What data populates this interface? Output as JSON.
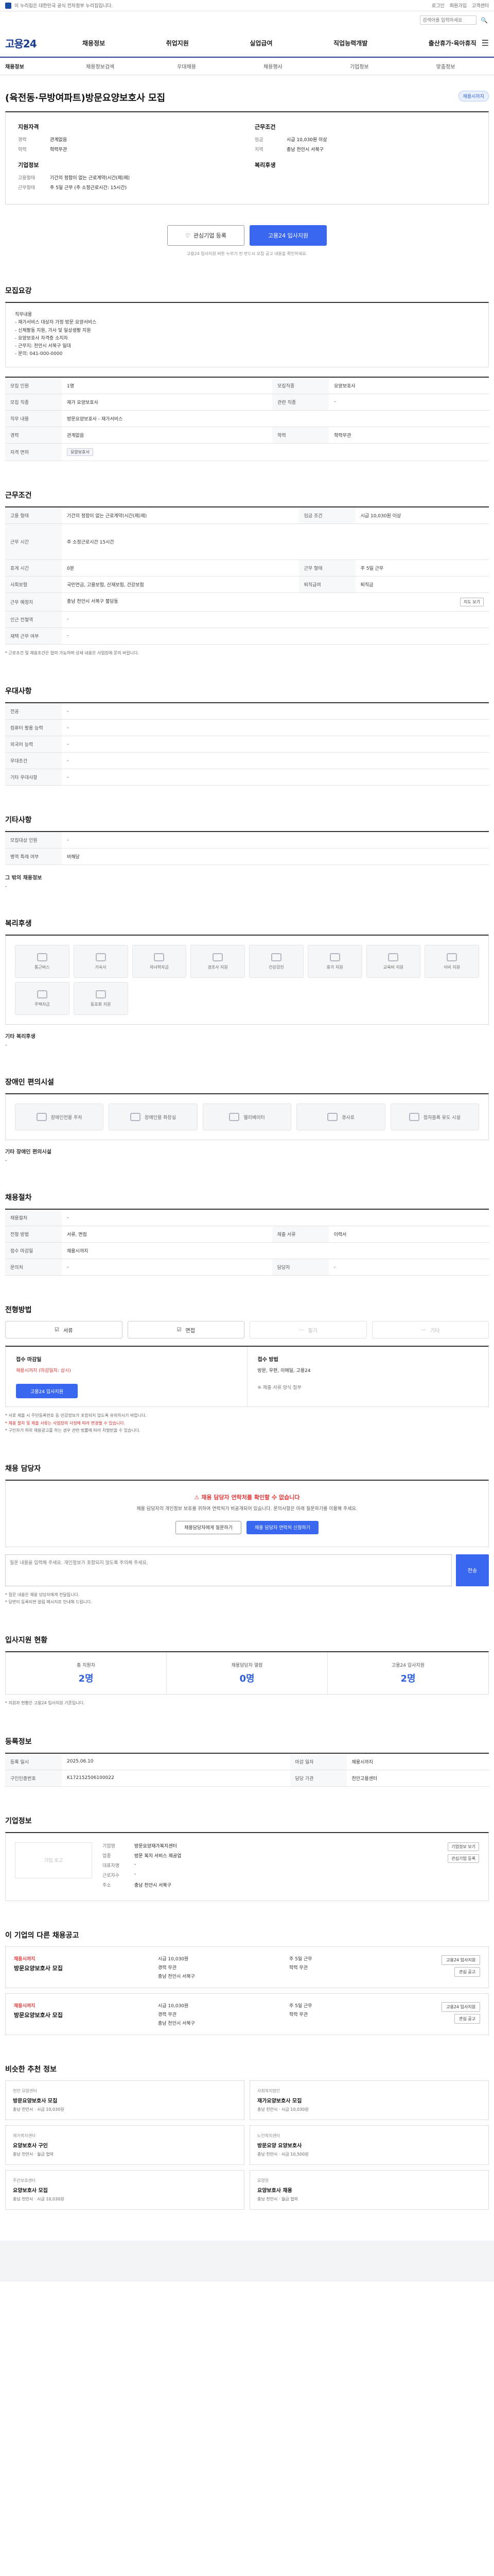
{
  "topbar": {
    "gov_text": "이 누리집은 대한민국 공식 전자정부 누리집입니다.",
    "links": [
      "로그인",
      "회원가입",
      "고객센터"
    ]
  },
  "search": {
    "placeholder": "검색어를 입력하세요"
  },
  "header": {
    "logo": "고용24",
    "gnb": [
      "채용정보",
      "취업지원",
      "실업급여",
      "직업능력개발",
      "출산휴가·육아휴직"
    ]
  },
  "subnav": [
    "채용정보",
    "채용정보검색",
    "우대채용",
    "채용행사",
    "기업정보",
    "맞춤정보"
  ],
  "title": {
    "text": "(육전동·무방여파트)방문요양보호사 모집",
    "badge": "채용시까지"
  },
  "summary": {
    "left_title": "지원자격",
    "left": [
      {
        "k": "경력",
        "v": "관계없음"
      },
      {
        "k": "학력",
        "v": "학력무관"
      }
    ],
    "right_title": "근무조건",
    "right": [
      {
        "k": "임금",
        "v": "시급 10,030원 이상"
      },
      {
        "k": "지역",
        "v": "충남 천안시 서북구"
      }
    ],
    "company_title": "기업정보",
    "company": [
      {
        "k": "고용형태",
        "v": "기간의 정함이 없는 근로계약(시간(제)제)"
      },
      {
        "k": "근무형태",
        "v": "주 5일 근무 (주 소정근로시간: 15시간)"
      }
    ],
    "bottom_label": "복리후생"
  },
  "apply": {
    "interest_label": "관심기업 등록",
    "apply_label": "고용24 입사지원",
    "note": "고용24 입사지원 버튼 누르기 전 반드시 모집 공고 내용을 확인하세요."
  },
  "recruit": {
    "title": "모집요강",
    "content": "직무내용\n - 재가서비스 대상자 가정 방문 요양서비스\n - 신체활동 지원, 가사 및 일상생활 지원\n - 요양보호사 자격증 소지자\n - 근무지: 천안시 서북구 일대\n - 문의: 041-000-0000"
  },
  "recruit_table": [
    {
      "k": "모집 인원",
      "v": "1명",
      "k2": "모집직종",
      "v2": "요양보호사"
    },
    {
      "k": "모집 직종",
      "v": "재가 요양보호사",
      "k2": "관련 직종",
      "v2": "-"
    },
    {
      "k": "직무 내용",
      "v": "방문요양보호사 - 재가서비스",
      "k2": "",
      "v2": ""
    },
    {
      "k": "경력",
      "v": "관계없음",
      "k2": "학력",
      "v2": "학력무관"
    },
    {
      "k": "자격 면허",
      "v": "요양보호사",
      "k2": "",
      "v2": ""
    }
  ],
  "conditions": {
    "title": "근무조건",
    "rows": [
      {
        "k": "고용 형태",
        "v": "기간의 정함이 없는 근로계약(시간(제)제)",
        "k2": "임금 조건",
        "v2": "시급 10,030원 이상"
      },
      {
        "k": "근무 시간",
        "v": "주 소정근로시간 15시간",
        "k2": "",
        "v2": ""
      },
      {
        "k": "휴게 시간",
        "v": "0분",
        "k2": "근무 형태",
        "v2": "주 5일 근무"
      },
      {
        "k": "사회보험",
        "v": "국민연금, 고용보험, 산재보험, 건강보험",
        "k2": "퇴직급여",
        "v2": "퇴직금"
      },
      {
        "k": "근무 예정지",
        "v": "충남 천안시 서북구 불당동",
        "k2": "",
        "v2": ""
      },
      {
        "k": "인근 전철역",
        "v": "-",
        "k2": "",
        "v2": ""
      },
      {
        "k": "재택 근무 여부",
        "v": "-",
        "k2": "",
        "v2": ""
      }
    ],
    "map_label": "지도 보기",
    "notice": "* 근로조건 및 채용조건은 협의 가능하며 상세 내용은 사업장에 문의 바랍니다."
  },
  "preferences": {
    "title": "우대사항",
    "rows": [
      {
        "k": "전공",
        "v": "-"
      },
      {
        "k": "컴퓨터 활용 능력",
        "v": "-"
      },
      {
        "k": "외국어 능력",
        "v": "-"
      },
      {
        "k": "우대조건",
        "v": "-"
      },
      {
        "k": "기타 우대사항",
        "v": "-"
      }
    ]
  },
  "extra": {
    "title": "기타사항",
    "rows": [
      {
        "k": "모집대상 인원",
        "v": "-"
      },
      {
        "k": "병역 특례 여부",
        "v": "비해당"
      }
    ],
    "more_label": "그 밖의 채용정보",
    "more_value": "-"
  },
  "welfare": {
    "title": "복리후생",
    "items": [
      "통근버스",
      "기숙사",
      "자녀학자금",
      "경조사 지원",
      "건강검진",
      "휴가 지원",
      "교육비 지원",
      "식비 지원",
      "주택자금",
      "동호회 지원"
    ],
    "other_label": "기타 복리후생",
    "other_value": "-"
  },
  "disability": {
    "title": "장애인 편의시설",
    "items": [
      "장애인전용 주차",
      "장애인용 화장실",
      "엘리베이터",
      "경사로",
      "점자블록 유도 시설"
    ],
    "other_label": "기타 장애인 편의시설",
    "other_value": "-"
  },
  "process": {
    "title": "채용절차",
    "rows": [
      {
        "k": "채용절차",
        "v": "-",
        "k2": "",
        "v2": ""
      },
      {
        "k": "전형 방법",
        "v": "서류, 면접",
        "k2": "제출 서류",
        "v2": "이력서"
      },
      {
        "k": "접수 마감일",
        "v": "채용시까지",
        "k2": "",
        "v2": ""
      },
      {
        "k": "문의처",
        "v": "-",
        "k2": "담당자",
        "v2": "-"
      }
    ]
  },
  "method": {
    "title": "전형방법",
    "chips": [
      {
        "label": "서류",
        "on": true
      },
      {
        "label": "면접",
        "on": true
      },
      {
        "label": "필기",
        "on": false
      },
      {
        "label": "기타",
        "on": false
      }
    ],
    "left_title": "접수 마감일",
    "left_value": "채용시까지 (마감일자: 상시)",
    "left_button": "고용24 입사지원",
    "right_title": "접수 방법",
    "right_value": "방문, 우편, 이메일, 고용24",
    "right_sub": "※ 제출 서류 양식 첨부",
    "notes": [
      "* 서류 제출 시 주민등록번호 등 민감정보가 포함되지 않도록 유의하시기 바랍니다.",
      "* 채용 절차 및 제출 서류는 사업장의 사정에 따라 변경될 수 있습니다.",
      "* 구인자가 허위 채용광고를 하는 경우 관련 법률에 따라 처벌받을 수 있습니다."
    ]
  },
  "qa": {
    "title": "채용 담당자",
    "warn": "채용 담당자 연락처를 확인할 수 없습니다",
    "desc": "채용 담당자의 개인정보 보호를 위하여 연락처가 비공개되어 있습니다. 문의사항은 아래 질문하기를 이용해 주세요.",
    "btn1": "채용담당자에게 질문하기",
    "btn2": "채용 담당자 연락처 신청하기",
    "textarea_placeholder": "질문 내용을 입력해 주세요. 개인정보가 포함되지 않도록 주의해 주세요.",
    "send": "전송",
    "notes": [
      "* 질문 내용은 채용 담당자에게 전달됩니다.",
      "* 답변이 등록되면 알림 메시지로 안내해 드립니다."
    ]
  },
  "stats": {
    "title": "입사지원 현황",
    "items": [
      {
        "label": "총 지원자",
        "num": "2명"
      },
      {
        "label": "채용담당자 열람",
        "num": "0명"
      },
      {
        "label": "고용24 입사지원",
        "num": "2명"
      }
    ],
    "note": "* 지원자 현황은 고용24 입사지원 기준입니다."
  },
  "info_reg": {
    "title": "등록정보",
    "rows": [
      {
        "k": "등록 일시",
        "v": "2025.06.10",
        "k2": "마감 일자",
        "v2": "채용시까지"
      },
      {
        "k": "구인인증번호",
        "v": "K172152506100022",
        "k2": "담당 기관",
        "v2": "천안고용센터"
      }
    ]
  },
  "company": {
    "title": "기업정보",
    "logo_placeholder": "기업 로고",
    "rows": [
      {
        "k": "기업명",
        "v": "방문요양재가복지센터"
      },
      {
        "k": "업종",
        "v": "방문 복지 서비스 제공업"
      },
      {
        "k": "대표자명",
        "v": "-"
      },
      {
        "k": "근로자수",
        "v": "-"
      },
      {
        "k": "주소",
        "v": "충남 천안시 서북구"
      }
    ],
    "buttons": [
      "기업정보 보기",
      "관심기업 등록"
    ]
  },
  "same_company": {
    "title": "이 기업의 다른 채용공고",
    "cards": [
      {
        "badge": "채용시까지",
        "title": "방문요양보호사 모집",
        "meta": [
          "시급 10,030원",
          "주 5일 근무",
          "경력 무관",
          "학력 무관",
          "충남 천안시 서북구"
        ],
        "actions": [
          "고용24 입사지원",
          "관심 공고"
        ]
      },
      {
        "badge": "채용시까지",
        "title": "방문요양보호사 모집",
        "meta": [
          "시급 10,030원",
          "주 5일 근무",
          "경력 무관",
          "학력 무관",
          "충남 천안시 서북구"
        ],
        "actions": [
          "고용24 입사지원",
          "관심 공고"
        ]
      }
    ]
  },
  "recommend": {
    "title": "비슷한 추천 정보",
    "items": [
      {
        "company": "천안 요양센터",
        "title": "방문요양보호사 모집",
        "meta": "충남 천안시 · 시급 10,030원"
      },
      {
        "company": "사회복지법인",
        "title": "재가요양보호사 모집",
        "meta": "충남 천안시 · 시급 10,030원"
      },
      {
        "company": "재가복지센터",
        "title": "요양보호사 구인",
        "meta": "충남 천안시 · 월급 협의"
      },
      {
        "company": "노인복지센터",
        "title": "방문요양 요양보호사",
        "meta": "충남 천안시 · 시급 10,500원"
      },
      {
        "company": "주간보호센터",
        "title": "요양보호사 모집",
        "meta": "충남 천안시 · 시급 10,030원"
      },
      {
        "company": "요양원",
        "title": "요양보호사 채용",
        "meta": "충남 천안시 · 월급 협의"
      }
    ]
  }
}
